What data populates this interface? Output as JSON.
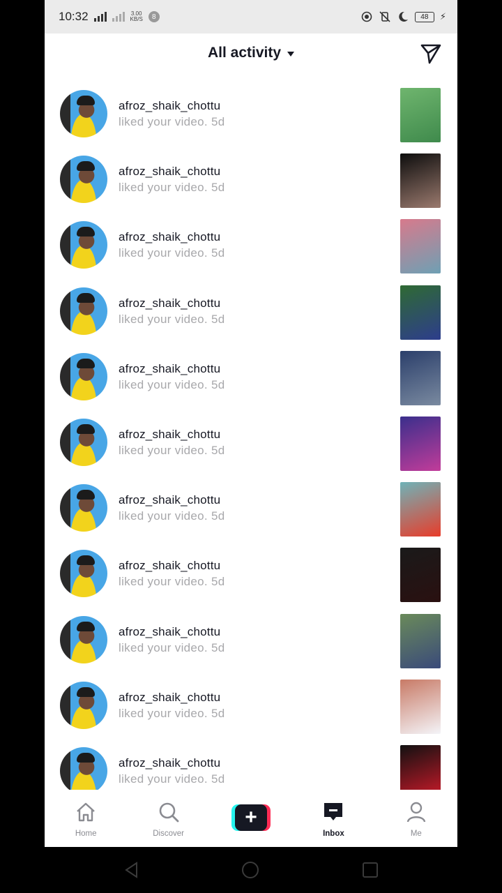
{
  "status_bar": {
    "time": "10:32",
    "net_speed_top": "3.00",
    "net_speed_bottom": "KB/S",
    "notification_count": "8",
    "battery": "48"
  },
  "header": {
    "title": "All activity",
    "send_icon": "send-paper-plane-icon"
  },
  "activity": [
    {
      "username": "afroz_shaik_chottu",
      "message": "liked your video. 5d",
      "thumb_colors": [
        "#6fb56e",
        "#3f8a4c"
      ]
    },
    {
      "username": "afroz_shaik_chottu",
      "message": "liked your video. 5d",
      "thumb_colors": [
        "#0d0d0d",
        "#9b7a6e"
      ]
    },
    {
      "username": "afroz_shaik_chottu",
      "message": "liked your video. 5d",
      "thumb_colors": [
        "#d77a8c",
        "#6ea0b4"
      ]
    },
    {
      "username": "afroz_shaik_chottu",
      "message": "liked your video. 5d",
      "thumb_colors": [
        "#2f6a33",
        "#2d3d8c"
      ]
    },
    {
      "username": "afroz_shaik_chottu",
      "message": "liked your video. 5d",
      "thumb_colors": [
        "#2b3f6b",
        "#7a8aa0"
      ]
    },
    {
      "username": "afroz_shaik_chottu",
      "message": "liked your video. 5d",
      "thumb_colors": [
        "#3a2f8c",
        "#c23c9a"
      ]
    },
    {
      "username": "afroz_shaik_chottu",
      "message": "liked your video. 5d",
      "thumb_colors": [
        "#6fb3b8",
        "#e83c2a"
      ]
    },
    {
      "username": "afroz_shaik_chottu",
      "message": "liked your video. 5d",
      "thumb_colors": [
        "#1a1a1a",
        "#2a1010"
      ]
    },
    {
      "username": "afroz_shaik_chottu",
      "message": "liked your video. 5d",
      "thumb_colors": [
        "#6a8a5a",
        "#3a4a7a"
      ]
    },
    {
      "username": "afroz_shaik_chottu",
      "message": "liked your video. 5d",
      "thumb_colors": [
        "#c87a66",
        "#f4f4f8"
      ]
    },
    {
      "username": "afroz_shaik_chottu",
      "message": "liked your video. 5d",
      "thumb_colors": [
        "#111111",
        "#d01a2a"
      ]
    }
  ],
  "bottom_nav": {
    "home": "Home",
    "discover": "Discover",
    "inbox": "Inbox",
    "me": "Me",
    "active": "Inbox"
  },
  "colors": {
    "brand_cyan": "#25f4ee",
    "brand_red": "#fe2c55",
    "text_primary": "#161823",
    "text_secondary": "#a8a8ab"
  }
}
